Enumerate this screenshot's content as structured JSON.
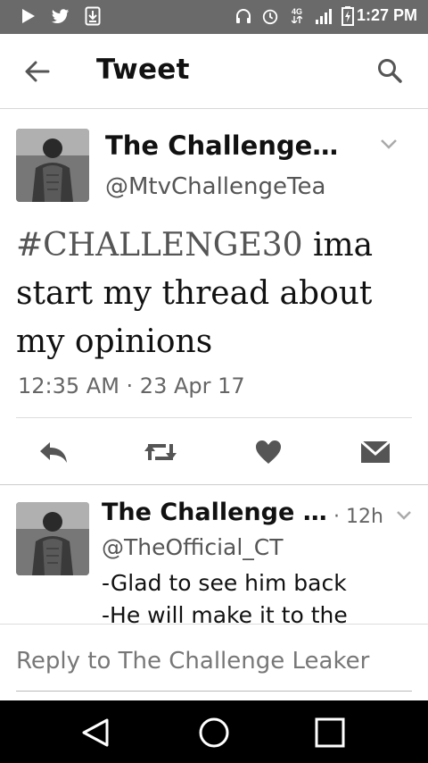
{
  "status_bar": {
    "time": "1:27 PM",
    "network": "4G"
  },
  "app_bar": {
    "title": "Tweet"
  },
  "tweet": {
    "name": "The Challenge…",
    "handle": "@MtvChallengeTea",
    "hashtag": "#CHALLENGE30",
    "text_rest": " ima start my thread about my opinions",
    "timestamp": "12:35 AM · 23 Apr 17"
  },
  "reply": {
    "name": "The Challenge …",
    "time": "· 12h",
    "handle": "@TheOfficial_CT",
    "line1": "-Glad to see him back",
    "line2": "-He will make it to the"
  },
  "composer": {
    "placeholder": "Reply to The Challenge Leaker"
  },
  "colors": {
    "status_bar": "#6a6a6a",
    "text": "#111111",
    "muted": "#666666",
    "nav_bar": "#000000"
  }
}
